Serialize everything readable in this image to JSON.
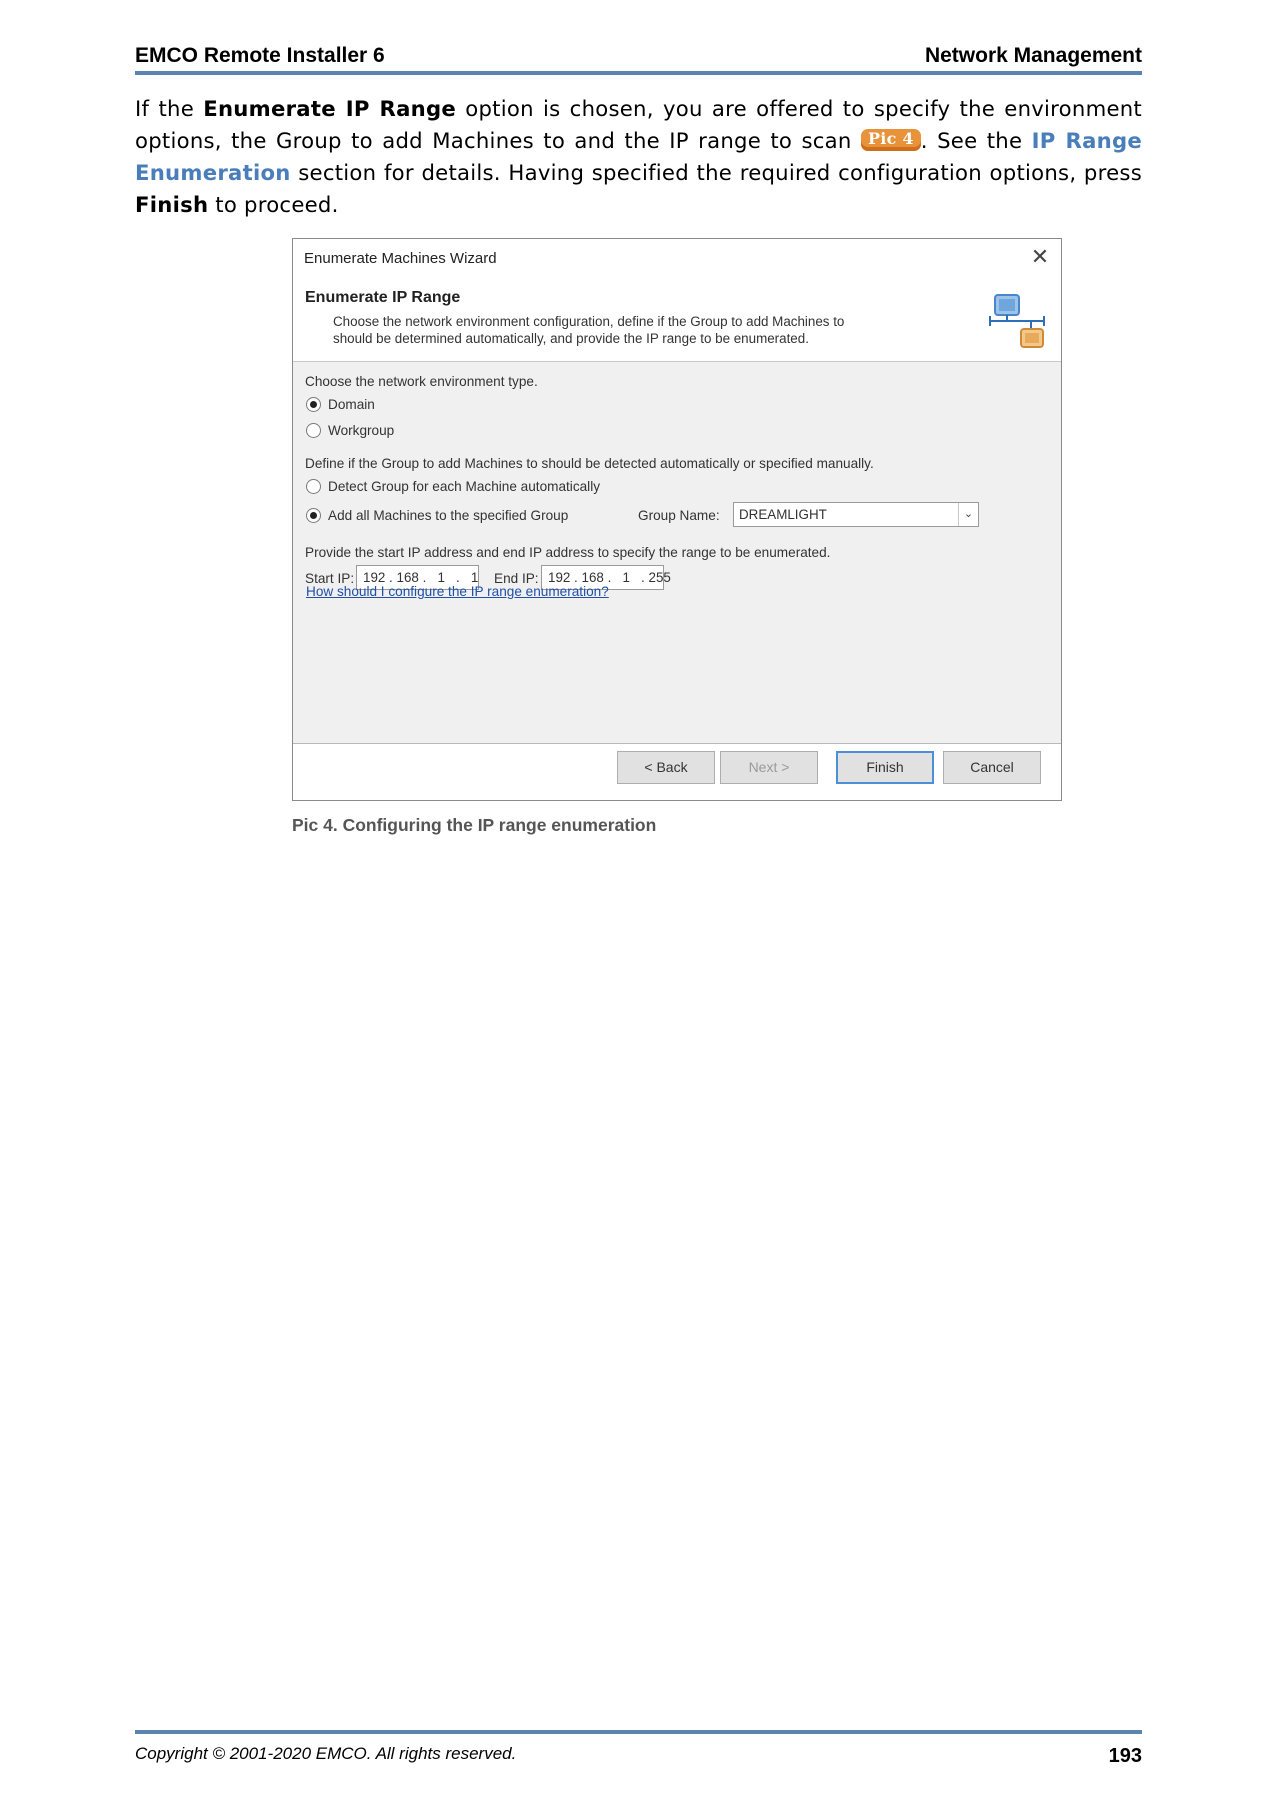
{
  "header": {
    "left": "EMCO Remote Installer 6",
    "right": "Network Management"
  },
  "paragraph": {
    "t1": "If the ",
    "b1": "Enumerate IP Range",
    "t2": " option is chosen, you are offered to specify the environment options, the Group to add Machines to and the IP range to scan ",
    "badge": "Pic 4",
    "t3": ". See the ",
    "link": "IP Range Enumeration",
    "t4": " section for details. Having specified the required configuration options, press ",
    "b2": "Finish",
    "t5": " to proceed."
  },
  "dialog": {
    "title": "Enumerate Machines Wizard",
    "close": "✕",
    "heading": "Enumerate IP Range",
    "description": "Choose the network environment configuration, define if the Group to add Machines to should be determined automatically, and provide the IP range to be enumerated.",
    "env_label": "Choose the network environment type.",
    "env_options": [
      "Domain",
      "Workgroup"
    ],
    "env_selected": "Domain",
    "group_label": "Define if the Group to add Machines to should be detected automatically or specified manually.",
    "group_options": [
      "Detect Group for each Machine automatically",
      "Add all Machines to the specified Group"
    ],
    "group_selected": "Add all Machines to the specified Group",
    "group_name_label": "Group Name:",
    "group_name_value": "DREAMLIGHT",
    "ip_label": "Provide the start IP address and end IP address to specify the range to be enumerated.",
    "start_ip_label": "Start IP:",
    "start_ip_value": "192 . 168 .   1   .   1",
    "end_ip_label": "End IP:",
    "end_ip_value": "192 . 168 .   1   . 255",
    "help_link": "How should I configure the IP range enumeration?",
    "buttons": {
      "back": "< Back",
      "next": "Next >",
      "finish": "Finish",
      "cancel": "Cancel"
    },
    "icon": "wizard-network-icon"
  },
  "caption": "Pic 4. Configuring the IP range enumeration",
  "footer": {
    "copyright": "Copyright © 2001-2020 EMCO. All rights reserved.",
    "page_number": "193"
  },
  "colors": {
    "rule": "#5b84b1",
    "link": "#4a7ebb",
    "badge": "#e8923a"
  }
}
